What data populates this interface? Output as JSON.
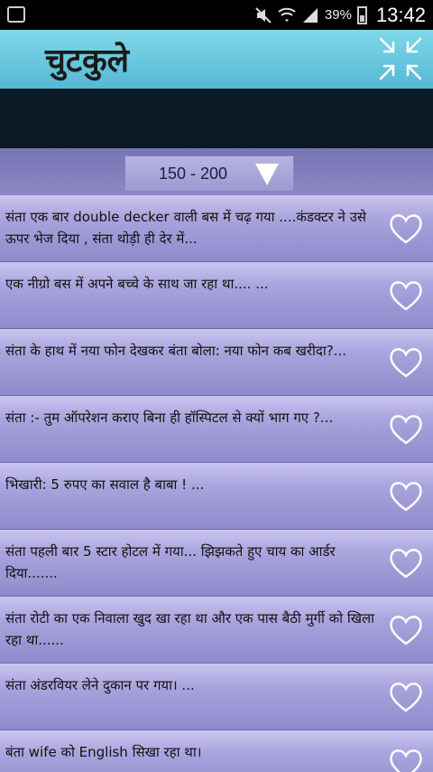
{
  "status_bar": {
    "battery": "39%",
    "time": "13:42",
    "icons": [
      "app-notification-icon",
      "mute-icon",
      "wifi-icon",
      "signal-icon",
      "battery-icon"
    ]
  },
  "app": {
    "title": "चुटकुले",
    "collapse_icon": "collapse-arrows-icon"
  },
  "range": {
    "label": "150 - 200",
    "dropdown_icon": "triangle-down-icon"
  },
  "jokes": [
    {
      "text": "संता एक बार double decker वाली बस में चढ़ गया ....कंडक्टर ने उसे ऊपर भेज दिया , संता थोड़ी ही देर में..."
    },
    {
      "text": "एक नीग्रो बस में अपने बच्चे के साथ जा रहा था.... ..."
    },
    {
      "text": "संता के हाथ में नया फोन देखकर बंता बोला: नया फोन कब खरीदा?..."
    },
    {
      "text": "संता :- तुम ऑपरेशन कराए बिना ही हॉस्पिटल से क्यों भाग गए ?..."
    },
    {
      "text": "भिखारी: 5 रुपए का सवाल है बाबा ! ..."
    },
    {
      "text": "संता पहली बार 5 स्टार होटल में गया... झिझकते हुए चाय का आर्डर दिया......."
    },
    {
      "text": "संता रोटी का एक निवाला खुद खा रहा था और एक पास बैठी मुर्गी को खिला रहा था......"
    },
    {
      "text": "संता अंडरवियर लेने दुकान पर गया। ..."
    },
    {
      "text": "बंता wife को English सिखा रहा था।"
    }
  ],
  "colors": {
    "header": "#6fcde4",
    "banner": "#0b1a24",
    "row_top": "#c9c5ef",
    "row_bottom": "#8f8acb"
  }
}
